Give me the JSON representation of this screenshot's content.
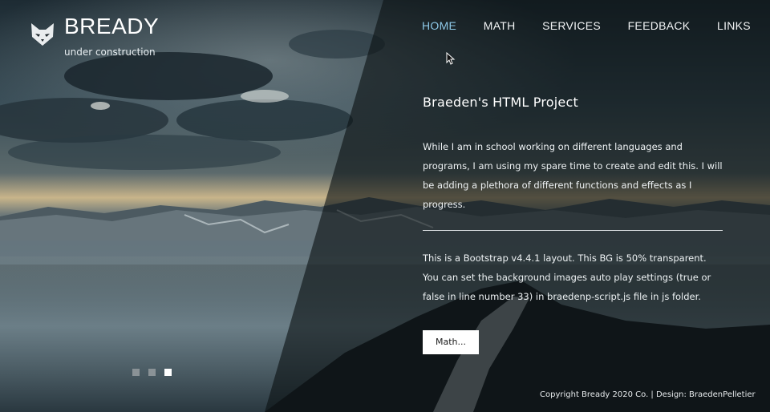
{
  "brand": {
    "title": "BREADY",
    "subtitle": "under construction",
    "logo_icon": "cat-icon"
  },
  "nav": {
    "items": [
      {
        "label": "HOME",
        "active": true
      },
      {
        "label": "MATH",
        "active": false
      },
      {
        "label": "SERVICES",
        "active": false
      },
      {
        "label": "FEEDBACK",
        "active": false
      },
      {
        "label": "LINKS",
        "active": false
      }
    ],
    "active_color": "#8ec9e8"
  },
  "main": {
    "heading": "Braeden's HTML Project",
    "intro": "While I am in school working on different languages and programs, I am using my spare time to create and edit this. I will be adding a plethora of different functions and effects as I progress.",
    "description": "This is a Bootstrap v4.4.1 layout. This BG is 50% transparent. You can set the background images auto play settings (true or false in line number 33) in braedenp-script.js file in js folder.",
    "button_label": "Math..."
  },
  "carousel": {
    "slides": 3,
    "active_index": 2
  },
  "footer": {
    "text": "Copyright Bready 2020 Co. | Design: BraedenPelletier"
  }
}
